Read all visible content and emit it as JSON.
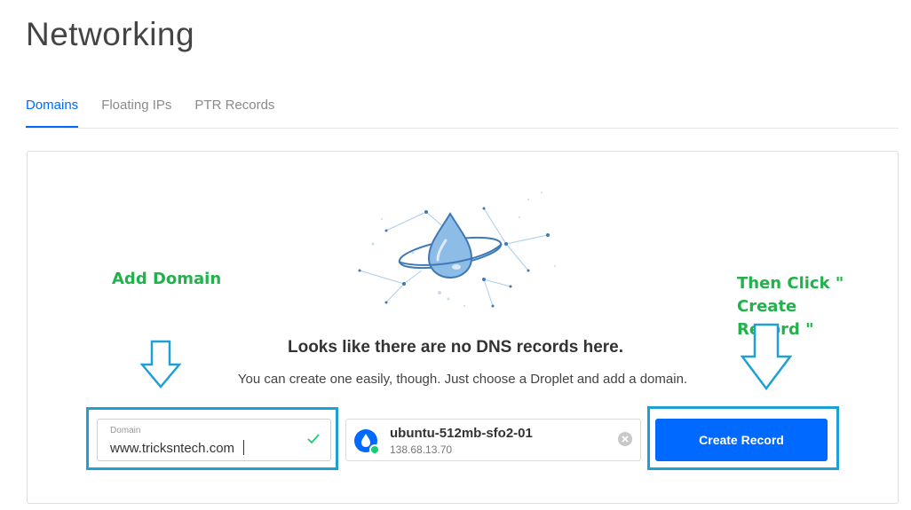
{
  "page": {
    "title": "Networking"
  },
  "tabs": [
    {
      "label": "Domains",
      "active": true
    },
    {
      "label": "Floating IPs",
      "active": false
    },
    {
      "label": "PTR Records",
      "active": false
    }
  ],
  "empty_state": {
    "heading": "Looks like there are no DNS records here.",
    "subtext": "You can create one easily, though. Just choose a Droplet and add a domain."
  },
  "form": {
    "domain_label": "Domain",
    "domain_value": "www.tricksntech.com",
    "droplet_name": "ubuntu-512mb-sfo2-01",
    "droplet_ip": "138.68.13.70",
    "create_button_label": "Create Record"
  },
  "annotations": {
    "add_domain": "Add Domain",
    "create_record_line1": "Then Click \" Create",
    "create_record_line2": "Record \""
  },
  "icons": {
    "droplet_status": "status-online-icon",
    "input_valid": "check-icon",
    "clear": "clear-icon"
  },
  "colors": {
    "accent": "#0069ff",
    "annotation_text": "#22b24c",
    "annotation_box": "#1ea0d6",
    "status_online": "#15cd72"
  }
}
